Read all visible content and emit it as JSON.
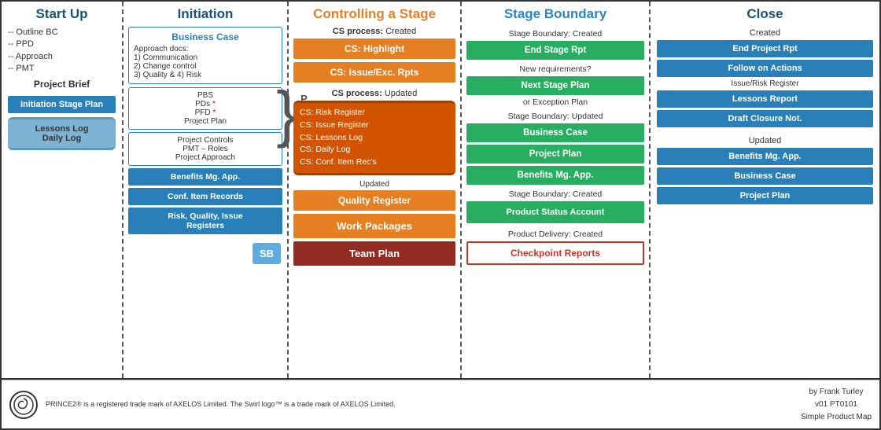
{
  "columns": {
    "startup": {
      "header": "Start Up",
      "items": [
        "-- Outline BC",
        "-- PPD",
        "-- Approach",
        "-- PMT"
      ],
      "project_brief": "Project Brief",
      "initiation_stage_plan": "Initiation Stage Plan",
      "lessons_log": "Lessons Log",
      "daily_log": "Daily Log"
    },
    "initiation": {
      "header": "Initiation",
      "business_case": "Business Case",
      "approach_docs": "Approach docs:\n1) Communication\n2) Change control\n3) Quality & 4) Risk",
      "pbs": "PBS",
      "pds": "PDs",
      "pfd": "PFD",
      "project_plan": "Project Plan",
      "project_controls": "Project Controls",
      "pmt_roles": "PMT – Roles",
      "project_approach": "Project Approach",
      "benefits_mg": "Benefits Mg. App.",
      "conf_item": "Conf. Item Records",
      "risk_quality": "Risk, Quality, Issue\nRegisters",
      "pid_label": "P\nI\nD",
      "sb_label": "SB"
    },
    "controlling": {
      "header": "Controlling a Stage",
      "cs_created": "CS process:",
      "cs_created_val": "Created",
      "highlight": "CS:  Highlight",
      "issue_exc": "CS:  Issue/Exc. Rpts",
      "cs_updated": "CS process:",
      "cs_updated_val": "Updated",
      "risk_register": "CS: Risk Register",
      "issue_register": "CS: Issue Register",
      "lessons_log": "CS: Lessons Log",
      "daily_log": "CS: Daily Log",
      "conf_item_rec": "CS: Conf. Item Rec's",
      "updated_label": "Updated",
      "quality_register": "Quality Register",
      "work_packages": "Work Packages",
      "team_plan": "Team Plan"
    },
    "stage_boundary": {
      "header": "Stage Boundary",
      "sb_created_label": "Stage Boundary: Created",
      "end_stage_rpt": "End Stage Rpt",
      "new_requirements": "New requirements?",
      "next_stage_plan": "Next Stage Plan",
      "or_exception": "or Exception Plan",
      "sb_updated_label": "Stage Boundary: Updated",
      "business_case": "Business Case",
      "project_plan": "Project  Plan",
      "benefits_mg": "Benefits Mg. App.",
      "sb_created2": "Stage Boundary: Created",
      "product_status": "Product Status Account",
      "product_delivery": "Product Delivery: Created",
      "checkpoint_reports": "Checkpoint Reports"
    },
    "close": {
      "header": "Close",
      "created_label": "Created",
      "end_project_rpt": "End Project Rpt",
      "follow_on": "Follow on Actions",
      "issue_risk": "Issue/Risk Register",
      "lessons_report": "Lessons Report",
      "draft_closure": "Draft Closure Not.",
      "updated_label": "Updated",
      "benefits_mg": "Benefits Mg. App.",
      "business_case": "Business Case",
      "project_plan": "Project Plan"
    }
  },
  "footer": {
    "trademark_text": "PRINCE2® is a registered trade mark of AXELOS Limited.\nThe Swirl logo™ is a trade mark of AXELOS Limited.",
    "author": "by Frank Turley",
    "version": "v01  PT0101",
    "map_type": "Simple Product Map"
  }
}
